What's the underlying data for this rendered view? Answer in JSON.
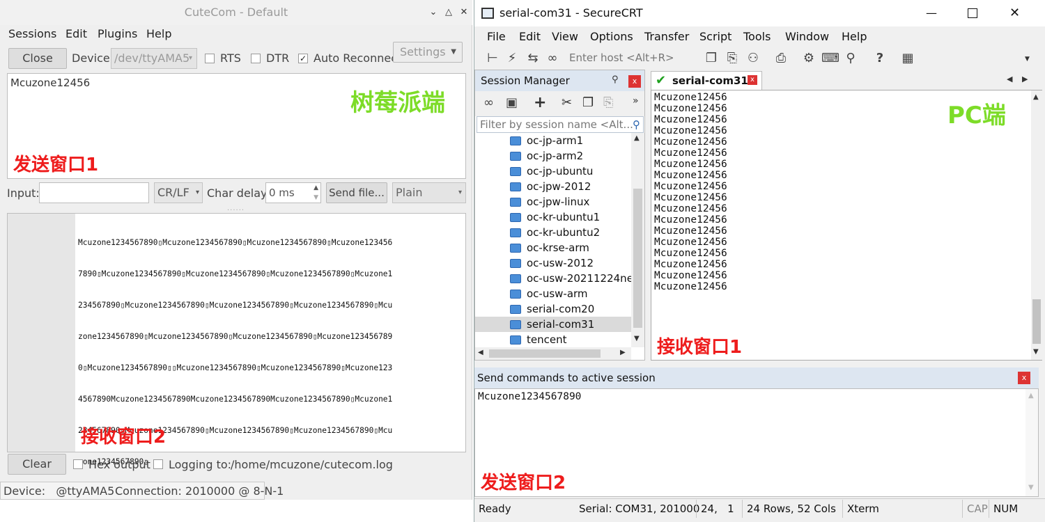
{
  "cutecom": {
    "title": "CuteCom - Default",
    "menu": [
      "Sessions",
      "Edit",
      "Plugins",
      "Help"
    ],
    "close_label": "Close",
    "device_label": "Device:",
    "device_value": "/dev/ttyAMA5",
    "rts_label": "RTS",
    "dtr_label": "DTR",
    "auto_reconnect_label": "Auto Reconnect",
    "settings_label": "Settings",
    "send_window_text": "Mcuzone12456",
    "pi_label": "树莓派端",
    "send_label": "发送窗口1",
    "input_label": "Input:",
    "input_value": "",
    "line_end": "CR/LF",
    "char_delay_label": "Char delay:",
    "char_delay_value": "0 ms",
    "send_file_label": "Send file...",
    "format": "Plain",
    "receive_lines": [
      "Mcuzone1234567890▯Mcuzone1234567890▯Mcuzone1234567890▯Mcuzone123456",
      "7890▯Mcuzone1234567890▯Mcuzone1234567890▯Mcuzone1234567890▯Mcuzone1",
      "234567890▯Mcuzone1234567890▯Mcuzone1234567890▯Mcuzone1234567890▯Mcu",
      "zone1234567890▯Mcuzone1234567890▯Mcuzone1234567890▯Mcuzone123456789",
      "0▯Mcuzone1234567890▯▯Mcuzone1234567890▯Mcuzone1234567890▯Mcuzone123",
      "4567890Mcuzone1234567890Mcuzone1234567890Mcuzone1234567890▯Mcuzone1",
      "234567890▯Mcuzone1234567890▯Mcuzone1234567890▯Mcuzone1234567890▯Mcu",
      "zone1234567890▯"
    ],
    "receive_label": "接收窗口2",
    "clear_label": "Clear",
    "hex_output_label": "Hex output",
    "logging_label": "Logging to:",
    "log_path": "/home/mcuzone/cutecom.log",
    "status_device": "Device:   @ttyAMA5",
    "status_connection": "Connection:  2010000 @ 8-N-1"
  },
  "securecrt": {
    "title": "serial-com31 - SecureCRT",
    "menu": [
      "File",
      "Edit",
      "View",
      "Options",
      "Transfer",
      "Script",
      "Tools",
      "Window",
      "Help"
    ],
    "host_placeholder": "Enter host <Alt+R>",
    "session_manager_title": "Session Manager",
    "filter_placeholder": "Filter by session name <Alt...",
    "sessions": [
      "oc-jp-arm1",
      "oc-jp-arm2",
      "oc-jp-ubuntu",
      "oc-jpw-2012",
      "oc-jpw-linux",
      "oc-kr-ubuntu1",
      "oc-kr-ubuntu2",
      "oc-krse-arm",
      "oc-usw-2012",
      "oc-usw-20211224ne",
      "oc-usw-arm",
      "serial-com20",
      "serial-com31",
      "tencent"
    ],
    "selected_session": "serial-com31",
    "tab_label": "serial-com31",
    "terminal_lines": [
      "Mcuzone12456",
      "Mcuzone12456",
      "Mcuzone12456",
      "Mcuzone12456",
      "Mcuzone12456",
      "Mcuzone12456",
      "Mcuzone12456",
      "Mcuzone12456",
      "Mcuzone12456",
      "Mcuzone12456",
      "Mcuzone12456",
      "Mcuzone12456",
      "Mcuzone12456",
      "Mcuzone12456",
      "Mcuzone12456",
      "Mcuzone12456",
      "Mcuzone12456",
      "Mcuzone12456"
    ],
    "pc_label": "PC端",
    "receive_label": "接收窗口1",
    "send_commands_title": "Send commands to active session",
    "send_commands_text": "Mcuzone1234567890",
    "send_label": "发送窗口2",
    "status": {
      "ready": "Ready",
      "serial": "Serial: COM31, 201000",
      "cursor": "24,   1",
      "size": "24 Rows, 52 Cols",
      "term": "Xterm",
      "cap": "CAP",
      "num": "NUM"
    }
  },
  "colors": {
    "annotation_red": "#ee1c1c",
    "annotation_green": "#7ddc28"
  }
}
